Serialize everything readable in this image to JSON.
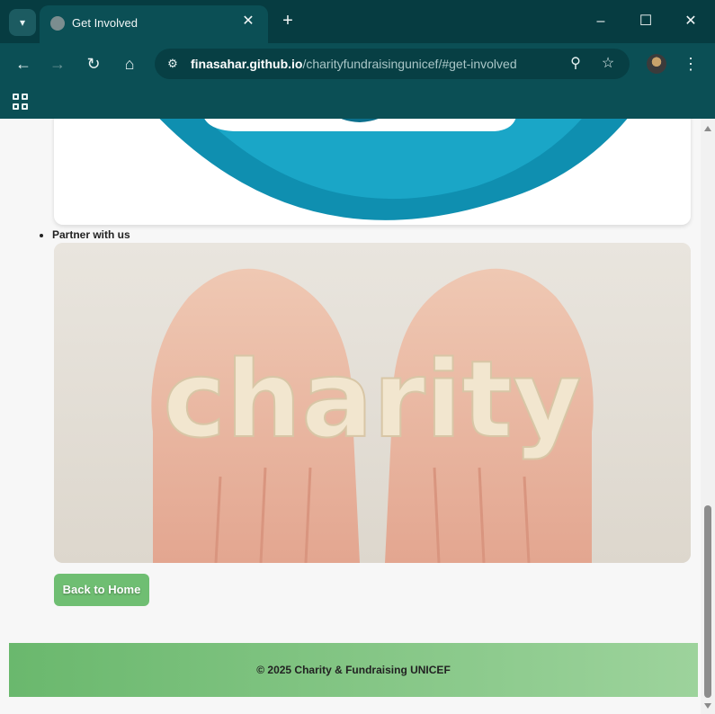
{
  "tab": {
    "title": "Get Involved",
    "close_glyph": "✕"
  },
  "new_tab_glyph": "+",
  "window_controls": {
    "minimize": "–",
    "maximize": "☐",
    "close": "✕"
  },
  "toolbar": {
    "back_glyph": "←",
    "forward_glyph": "→",
    "reload_glyph": "↻",
    "home_glyph": "⌂",
    "url_host": "finasahar.github.io",
    "url_path": "/charityfundraisingunicef/#get-involved",
    "zoom_glyph": "⚲",
    "star_glyph": "☆",
    "menu_glyph": "⋮"
  },
  "page": {
    "partner_label": "Partner with us",
    "photo_word": "charity",
    "back_button": "Back to Home",
    "footer_text": "© 2025 Charity & Fundraising UNICEF"
  },
  "colors": {
    "browser_frame": "#0b4f55",
    "logo_blue": "#0f8fb0",
    "button_green": "#6fbe72",
    "footer_start": "#6ab86d",
    "footer_end": "#9dd39c"
  }
}
